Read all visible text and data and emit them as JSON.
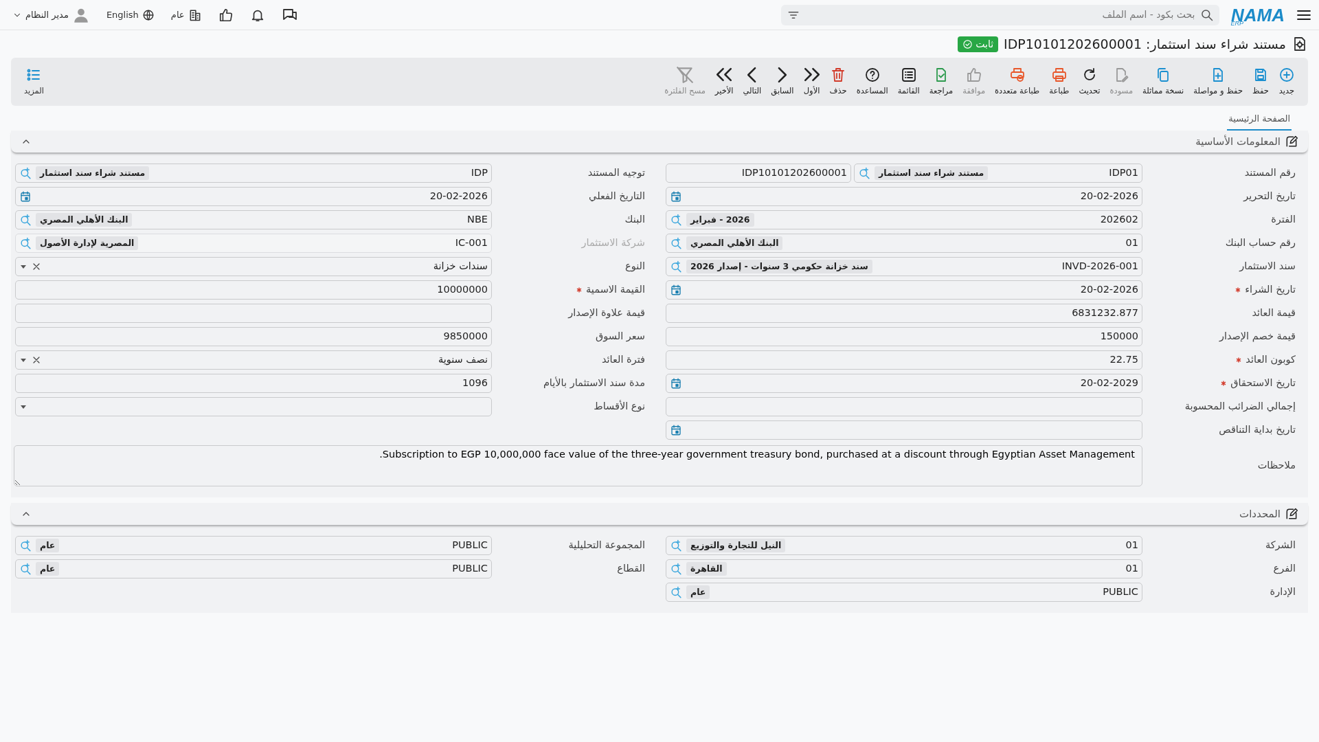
{
  "top_bar": {
    "logo": {
      "text": "NAMA",
      "subtext": "ERP"
    },
    "search": {
      "placeholder": "بحث بكود - اسم الملف"
    },
    "organization": "عام",
    "language": "English",
    "user": "مدير النظام"
  },
  "header": {
    "title": "مستند شراء سند استثمار: IDP10101202600001",
    "status": "ثابت"
  },
  "toolbar": {
    "actions": [
      {
        "label": "جديد",
        "kind": "new",
        "color": "#1a8fd0",
        "disabled": false
      },
      {
        "label": "حفظ",
        "kind": "save",
        "color": "#1a8fd0",
        "disabled": false
      },
      {
        "label": "حفظ و مواصلة",
        "kind": "save-continue",
        "color": "#1a8fd0",
        "disabled": false
      },
      {
        "label": "نسخة مماثلة",
        "kind": "copy",
        "color": "#1a8fd0",
        "disabled": false
      },
      {
        "label": "مسودة",
        "kind": "draft",
        "color": "#9a9a9a",
        "disabled": true
      },
      {
        "label": "تحديث",
        "kind": "refresh",
        "color": "#222222",
        "disabled": false
      },
      {
        "label": "طباعة",
        "kind": "print",
        "color": "#e8572a",
        "disabled": false
      },
      {
        "label": "طباعة متعددة",
        "kind": "print-multi",
        "color": "#e8572a",
        "disabled": false
      },
      {
        "label": "موافقة",
        "kind": "approve",
        "color": "#9a9a9a",
        "disabled": true
      },
      {
        "label": "مراجعة",
        "kind": "review",
        "color": "#2e9b4f",
        "disabled": false
      },
      {
        "label": "القائمة",
        "kind": "list",
        "color": "#222222",
        "disabled": false
      },
      {
        "label": "المساعدة",
        "kind": "help",
        "color": "#222222",
        "disabled": false
      },
      {
        "label": "حذف",
        "kind": "delete",
        "color": "#d23b2b",
        "disabled": false
      },
      {
        "label": "الأول",
        "kind": "first",
        "color": "#222222",
        "disabled": false
      },
      {
        "label": "السابق",
        "kind": "previous",
        "color": "#222222",
        "disabled": false
      },
      {
        "label": "التالي",
        "kind": "next",
        "color": "#222222",
        "disabled": false
      },
      {
        "label": "الأخير",
        "kind": "last",
        "color": "#222222",
        "disabled": false
      },
      {
        "label": "مسح الفلترة",
        "kind": "clear-filter",
        "color": "#9a9a9a",
        "disabled": true
      }
    ],
    "more": "المزيد"
  },
  "tabs": [
    {
      "label": "الصفحة الرئيسية",
      "selected": true
    }
  ],
  "sections": [
    {
      "title": "المعلومات الأساسية",
      "expanded": true,
      "columns": [
        [
          {
            "label": "رقم المستند",
            "kind": "lookup",
            "value": "IDP01",
            "description": "مستند شراء سند استثمار",
            "extra": "IDP10101202600001",
            "required": false,
            "disabled": false
          },
          {
            "label": "تاريخ التحرير",
            "kind": "date",
            "value": "20-02-2026",
            "required": false,
            "disabled": false
          },
          {
            "label": "الفترة",
            "kind": "lookup",
            "value": "202602",
            "description": "2026 - فبراير",
            "required": false,
            "disabled": false
          },
          {
            "label": "رقم حساب البنك",
            "kind": "lookup",
            "value": "01",
            "description": "البنك الأهلي المصري",
            "required": false,
            "disabled": false
          },
          {
            "label": "سند الاستثمار",
            "kind": "lookup",
            "value": "INVD-2026-001",
            "description": "سند خزانة حكومي 3 سنوات - إصدار 2026",
            "required": false,
            "disabled": false
          },
          {
            "label": "تاريخ الشراء",
            "kind": "date",
            "value": "20-02-2026",
            "required": true,
            "disabled": false
          },
          {
            "label": "قيمة العائد",
            "kind": "text",
            "value": "6831232.877",
            "required": false,
            "disabled": false
          },
          {
            "label": "قيمة خصم الإصدار",
            "kind": "text",
            "value": "150000",
            "required": false,
            "disabled": false
          },
          {
            "label": "كوبون العائد",
            "kind": "text",
            "value": "22.75",
            "required": true,
            "disabled": false
          },
          {
            "label": "تاريخ الاستحقاق",
            "kind": "date",
            "value": "20-02-2029",
            "required": true,
            "disabled": false
          },
          {
            "label": "إجمالي الضرائب المحسوبة",
            "kind": "text",
            "required": false,
            "disabled": false
          },
          {
            "label": "تاريخ بداية التناقص",
            "kind": "date",
            "required": false,
            "disabled": false
          }
        ],
        [
          {
            "label": "توجيه المستند",
            "kind": "lookup",
            "value": "IDP",
            "description": "مستند شراء سند استثمار",
            "required": false,
            "disabled": false
          },
          {
            "label": "التاريخ الفعلي",
            "kind": "date",
            "value": "20-02-2026",
            "required": false,
            "disabled": false
          },
          {
            "label": "البنك",
            "kind": "lookup",
            "value": "NBE",
            "description": "البنك الأهلي المصري",
            "required": false,
            "disabled": false
          },
          {
            "label": "شركة الاستثمار",
            "kind": "lookup",
            "value": "IC-001",
            "description": "المصرية لإدارة الأصول",
            "required": false,
            "disabled": true
          },
          {
            "label": "النوع",
            "kind": "select",
            "value": "سندات خزانة",
            "required": false,
            "disabled": false
          },
          {
            "label": "القيمة الاسمية",
            "kind": "text",
            "value": "10000000",
            "required": true,
            "disabled": false
          },
          {
            "label": "قيمة علاوة الإصدار",
            "kind": "text",
            "required": false,
            "disabled": false
          },
          {
            "label": "سعر السوق",
            "kind": "text",
            "value": "9850000",
            "required": false,
            "disabled": false
          },
          {
            "label": "فترة العائد",
            "kind": "select",
            "value": "نصف سنوية",
            "required": false,
            "disabled": false
          },
          {
            "label": "مدة سند الاستثمار بالأيام",
            "kind": "text",
            "value": "1096",
            "required": false,
            "disabled": false
          },
          {
            "label": "نوع الأقساط",
            "kind": "select",
            "required": false,
            "disabled": false
          }
        ]
      ],
      "notes": {
        "label": "ملاحظات",
        "value": "Subscription to EGP 10,000,000 face value of the three-year government treasury bond, purchased at a discount through Egyptian Asset Management."
      }
    },
    {
      "title": "المحددات",
      "expanded": true,
      "columns": [
        [
          {
            "label": "الشركة",
            "kind": "lookup",
            "value": "01",
            "description": "النيل للتجارة والتوزيع",
            "required": false,
            "disabled": false
          },
          {
            "label": "الفرع",
            "kind": "lookup",
            "value": "01",
            "description": "القاهرة",
            "required": false,
            "disabled": false
          },
          {
            "label": "الإدارة",
            "kind": "lookup",
            "value": "PUBLIC",
            "description": "عام",
            "required": false,
            "disabled": false
          }
        ],
        [
          {
            "label": "المجموعة التحليلية",
            "kind": "lookup",
            "value": "PUBLIC",
            "description": "عام",
            "required": false,
            "disabled": false
          },
          {
            "label": "القطاع",
            "kind": "lookup",
            "value": "PUBLIC",
            "description": "عام",
            "required": false,
            "disabled": false
          }
        ]
      ]
    }
  ]
}
